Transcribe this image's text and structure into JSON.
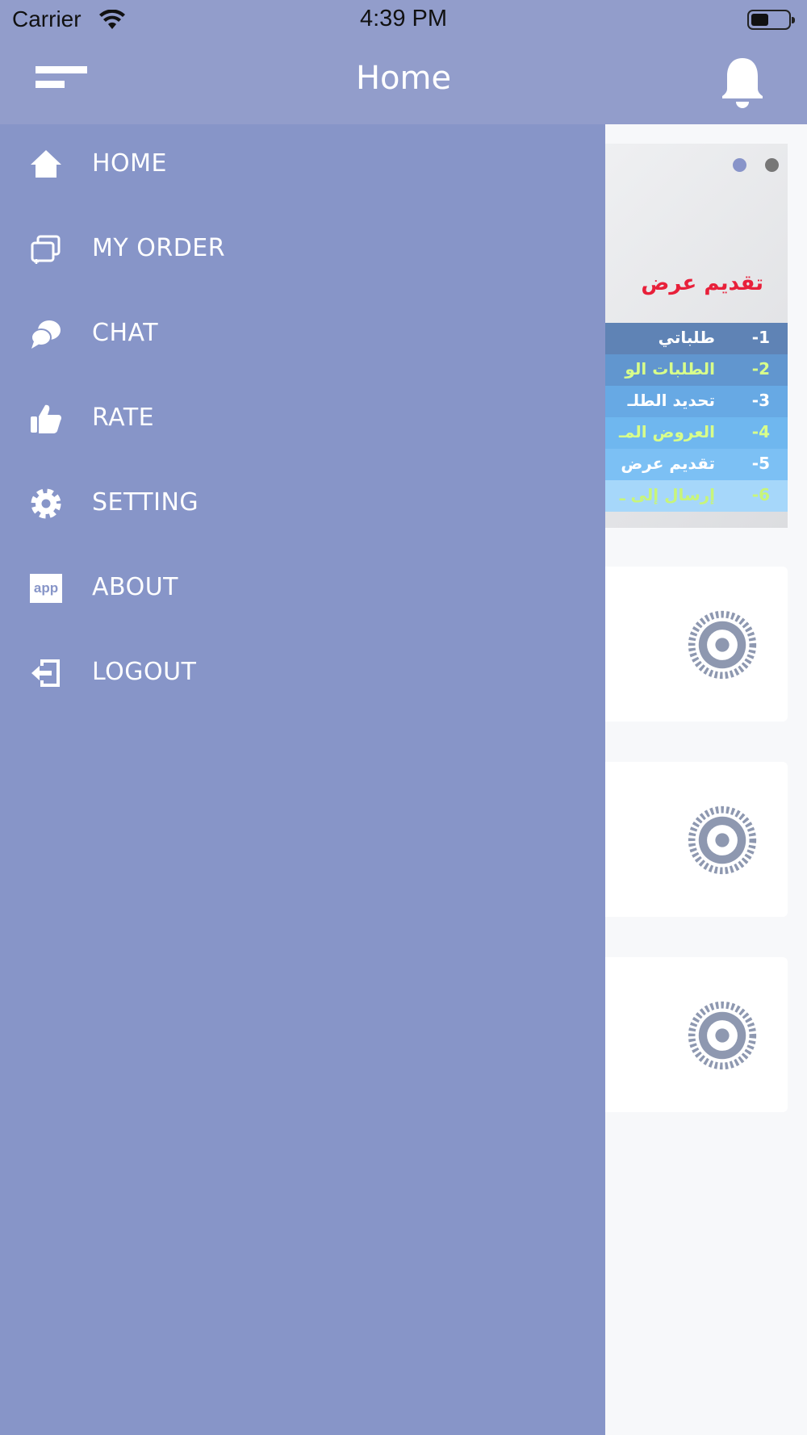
{
  "status_bar": {
    "carrier": "Carrier",
    "time": "4:39 PM",
    "battery_level": 0.45
  },
  "header": {
    "title": "Home",
    "menu_icon": "hamburger-menu-icon",
    "notification_icon": "bell-icon"
  },
  "drawer": {
    "items": [
      {
        "label": "HOME",
        "icon": "home-icon"
      },
      {
        "label": "MY ORDER",
        "icon": "orders-icon"
      },
      {
        "label": "CHAT",
        "icon": "chat-icon"
      },
      {
        "label": "RATE",
        "icon": "thumbs-up-icon"
      },
      {
        "label": "SETTING",
        "icon": "gear-icon"
      },
      {
        "label": "ABOUT",
        "icon": "app-icon"
      },
      {
        "label": "LOGOUT",
        "icon": "logout-icon"
      }
    ],
    "about_icon_text": "app"
  },
  "banner": {
    "heading": "تقديم عرض",
    "pager_dots": 2,
    "active_dot": 0,
    "rows": [
      {
        "num": "-1",
        "text": "طلباتي"
      },
      {
        "num": "-2",
        "text": "الطلبات الو"
      },
      {
        "num": "-3",
        "text": "تحديد الطلـ"
      },
      {
        "num": "-4",
        "text": "العروض المـ"
      },
      {
        "num": "-5",
        "text": "تقديم عرض"
      },
      {
        "num": "-6",
        "text": "إرسال إلى ـ"
      }
    ]
  },
  "colors": {
    "header_bg": "#929dcb",
    "drawer_bg": "#8795c8",
    "heading_red": "#e8203a",
    "row_text_white": "#ffffff",
    "row_text_green": "#d8ff8a",
    "gear_gray": "#8e98b0"
  },
  "content_cards": [
    {
      "icon": "gear-icon"
    },
    {
      "icon": "gear-icon"
    },
    {
      "icon": "gear-icon"
    }
  ]
}
